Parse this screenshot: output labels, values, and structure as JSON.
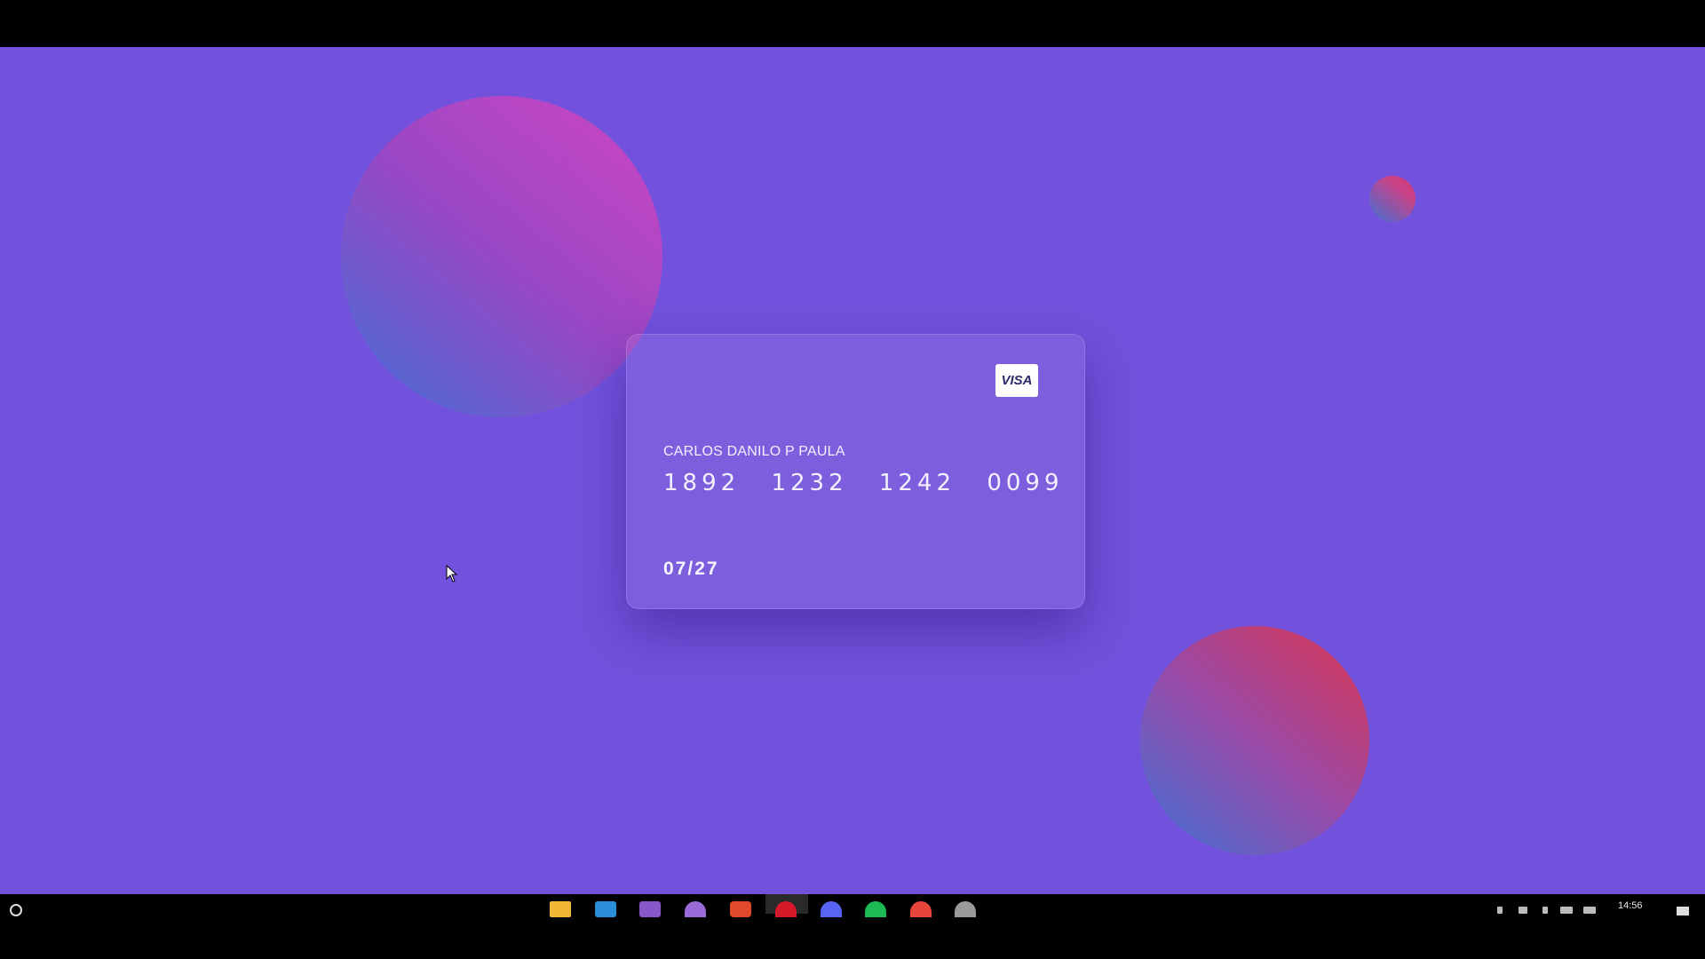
{
  "card": {
    "brand": "VISA",
    "holder": "CARLOS DANILO P PAULA",
    "number_groups": [
      "1892",
      "1232",
      "1242",
      "0099"
    ],
    "expiry": "07/27"
  },
  "colors": {
    "background": "#7252dc",
    "orb_blue": "#3f72d6",
    "orb_pink": "#d445c0",
    "orb_red": "#d8344f"
  },
  "taskbar": {
    "clock": "14:56",
    "apps": [
      {
        "name": "file-explorer-icon",
        "color": "#f2b636"
      },
      {
        "name": "vscode-icon",
        "color": "#2a8fd8"
      },
      {
        "name": "visual-studio-icon",
        "color": "#8557c8"
      },
      {
        "name": "obs-icon",
        "color": "#9a6ad8"
      },
      {
        "name": "app-red-icon",
        "color": "#e04a2a"
      },
      {
        "name": "opera-icon",
        "color": "#d61a2a"
      },
      {
        "name": "discord-icon",
        "color": "#5865f2"
      },
      {
        "name": "spotify-icon",
        "color": "#1db954"
      },
      {
        "name": "chrome-icon",
        "color": "#e8453c"
      },
      {
        "name": "github-icon",
        "color": "#9a9a9a"
      }
    ]
  }
}
